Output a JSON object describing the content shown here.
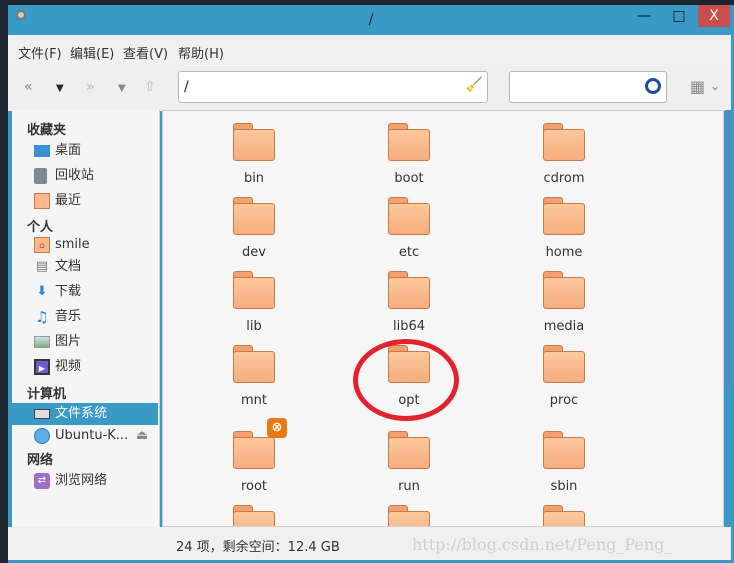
{
  "window": {
    "title": "/",
    "minimize": "—",
    "maximize": "□",
    "close": "X"
  },
  "menu": [
    "文件(F)",
    "编辑(E)",
    "查看(V)",
    "帮助(H)"
  ],
  "toolbar": {
    "back": "«",
    "back_dropdown": "▼",
    "forward": "»",
    "forward_dropdown": "▼",
    "up": "⇧",
    "path": "/",
    "search": "",
    "view_toggle": "▦",
    "view_dropdown": "⌄"
  },
  "sidebar": {
    "sections": [
      "收藏夹",
      "个人",
      "计算机",
      "网络"
    ],
    "items": [
      {
        "label": "桌面",
        "icon": "desktop-icon"
      },
      {
        "label": "回收站",
        "icon": "trash-icon"
      },
      {
        "label": "最近",
        "icon": "recent-folder-icon"
      },
      {
        "label": "smile",
        "icon": "home-folder-icon"
      },
      {
        "label": "文档",
        "icon": "document-icon"
      },
      {
        "label": "下载",
        "icon": "download-icon"
      },
      {
        "label": "音乐",
        "icon": "music-icon"
      },
      {
        "label": "图片",
        "icon": "picture-icon"
      },
      {
        "label": "视频",
        "icon": "video-icon"
      },
      {
        "label": "文件系统",
        "icon": "drive-icon",
        "selected": true
      },
      {
        "label": "Ubuntu-K...",
        "icon": "disc-icon"
      },
      {
        "label": "浏览网络",
        "icon": "network-icon"
      }
    ],
    "eject": "⏏"
  },
  "files": [
    "bin",
    "boot",
    "cdrom",
    "dev",
    "etc",
    "home",
    "lib",
    "lib64",
    "media",
    "mnt",
    "opt",
    "proc",
    "root",
    "run",
    "sbin",
    "",
    "",
    ""
  ],
  "status": "24 项，剩余空间：12.4 GB",
  "watermark": "http://blog.csdn.net/Peng_Peng_",
  "colors": {
    "accent": "#3a9ac6",
    "close": "#c94f4f",
    "circle": "#e3232b"
  }
}
